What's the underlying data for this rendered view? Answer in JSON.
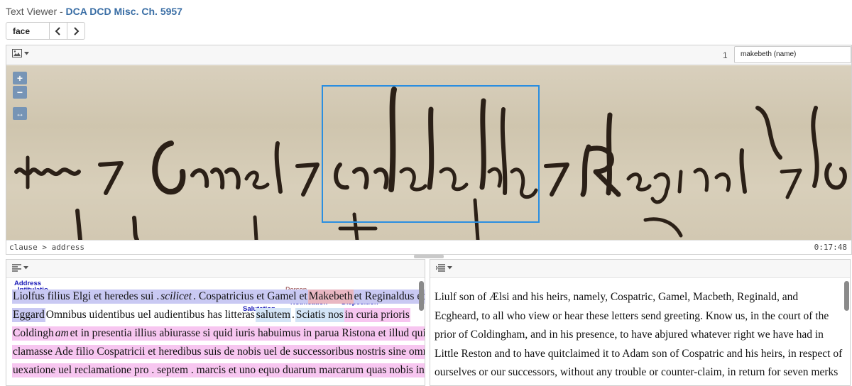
{
  "header": {
    "prefix": "Text Viewer - ",
    "doc_title": "DCA DCD Misc. Ch. 5957"
  },
  "nav": {
    "location": "face"
  },
  "image_viewer": {
    "page_number": "1",
    "selected_element": "makebeth (name)",
    "zoom_in": "+",
    "zoom_out": "−",
    "fit": "↔",
    "breadcrumb": "clause > address",
    "timestamp": "0:17:48",
    "icons": [
      "image-icon",
      "chevron-down-icon",
      "zoom-in-icon",
      "zoom-out-icon",
      "fit-width-icon"
    ]
  },
  "latin": {
    "tags": {
      "address": "Address",
      "intitulatio": "Intitulatio",
      "person": "Person",
      "salutation": "Salutation",
      "notification": "Notification",
      "disposition": "Disposition"
    },
    "l1_a": "Liolfus filius Elgi et heredes sui . ",
    "l1_b": "scilicet",
    "l1_c": " . Cospatricius et Gamel et ",
    "l1_d": "Makebeth",
    "l1_e": " et Reginaldus et",
    "l2_a": "Eggard ",
    "l2_b": " Omnibus uidentibus uel audientibus has litteras ",
    "l2_c": "salutem",
    "l2_d": " . ",
    "l2_e": " Sciatis nos ",
    "l2_f": " in curia prioris",
    "l3_a": "Coldingh",
    "l3_b": "am",
    "l3_c": " et in presentia illius abiurasse si quid iuris habuimus in parua Ristona et illud quietum",
    "l4": "clamasse Ade filio Cospatricii et heredibus suis de nobis uel de successoribus nostris sine omni",
    "l5": "uexatione uel reclamatione pro . septem . marcis et uno equo duarum marcarum quas nobis in"
  },
  "english": {
    "text": "Liulf son of Ælsi and his heirs, namely, Cospatric, Gamel, Macbeth, Reginald, and Ecgheard, to all who view or hear these letters send greeting. Know us, in the court of the prior of Coldingham, and in his presence, to have abjured whatever right we have had in Little Reston and to have quitclaimed it to Adam son of Cospatric and his heirs, in respect of ourselves or our successors, without any trouble or counter-claim, in return for seven merks and one horse of two merks which he has given to us in the"
  },
  "colors": {
    "accent": "#3a6ea5",
    "highlight_box": "#2a8ee0",
    "address_bg": "#c9c9f3",
    "disposition_bg": "#f7c6f0",
    "salutation_bg": "#d3e4f6"
  }
}
